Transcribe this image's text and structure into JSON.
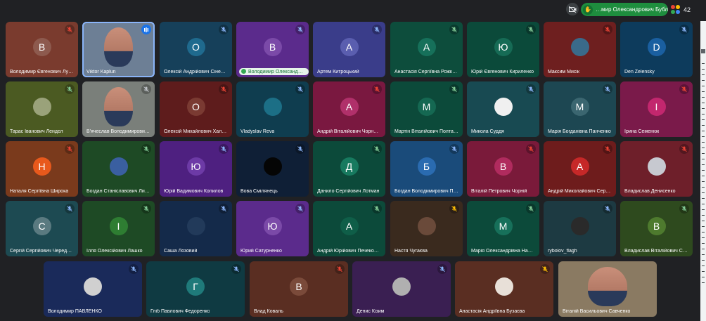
{
  "topbar": {
    "video_off_icon": "video-off-icon",
    "speaker_name": "…мир Олександрович Бубліченко",
    "people_count": "42"
  },
  "colors": {
    "mic_muted": "#ea4335",
    "mic_active": "#8ab4f8",
    "speaker_green": "#1e8e3e"
  },
  "tiles": [
    {
      "name": "Володимир Євгенович Лукін",
      "initial": "В",
      "bg": "#7a3b2e",
      "avbg": "#8d5a4e",
      "mic": "muted"
    },
    {
      "name": "Viktor Kaplun",
      "initial": "",
      "bg": "#6d7f95",
      "video": true,
      "mic": "open",
      "active": true
    },
    {
      "name": "Олексій Андрійович Сінел…",
      "initial": "О",
      "bg": "#16405a",
      "avbg": "#1f6a8e",
      "mic": "muted-blue"
    },
    {
      "name": "Володимир Олександр…",
      "initial": "В",
      "bg": "#5b2b8c",
      "avbg": "#7b4aa8",
      "mic": "muted-blue",
      "pill": true
    },
    {
      "name": "Артем Китроцький",
      "initial": "А",
      "bg": "#3a3d8a",
      "avbg": "#5a5eaf",
      "mic": "muted-blue"
    },
    {
      "name": "Анастасія Сергіївна Рожко…",
      "initial": "А",
      "bg": "#0d4d3c",
      "avbg": "#16705a",
      "mic": "muted-green"
    },
    {
      "name": "Юрій Євгенович Кириленко",
      "initial": "Ю",
      "bg": "#0b4a3a",
      "avbg": "#166b55",
      "mic": "muted-green"
    },
    {
      "name": "Максим Мисік",
      "initial": "",
      "bg": "#6e1f1f",
      "avbg": "#3a6a8a",
      "photo": true,
      "mic": "muted"
    },
    {
      "name": "Den Zelensky",
      "initial": "D",
      "bg": "#0d3b5c",
      "avbg": "#1a5fa0",
      "mic": "muted-blue"
    },
    {
      "name": "Тарас Іванович Лендєл",
      "initial": "",
      "bg": "#4b5a22",
      "avbg": "#9aa27a",
      "photo": true,
      "mic": "muted-green"
    },
    {
      "name": "В'ячеслав Володимирович …",
      "initial": "",
      "bg": "#7a7f7a",
      "video": true,
      "mic": "muted-gray"
    },
    {
      "name": "Олексій Михайлович Хала…",
      "initial": "О",
      "bg": "#5e1c1c",
      "avbg": "#7a3a32",
      "mic": "muted"
    },
    {
      "name": "Vladyslav Reva",
      "initial": "",
      "bg": "#0f3d4f",
      "avbg": "#1c6f86",
      "photo": true,
      "mic": "muted-blue"
    },
    {
      "name": "Андрій Віталійович Чорно…",
      "initial": "А",
      "bg": "#7a1840",
      "avbg": "#b0306a",
      "mic": "muted"
    },
    {
      "name": "Мартін Віталійович Полтава",
      "initial": "М",
      "bg": "#0c4a3a",
      "avbg": "#156852",
      "mic": "muted-green"
    },
    {
      "name": "Микола Суддя",
      "initial": "",
      "bg": "#184a52",
      "avbg": "#f0f0f0",
      "photo": true,
      "mic": "muted-blue"
    },
    {
      "name": "Марія Богданівна Панченко",
      "initial": "М",
      "bg": "#1d4752",
      "avbg": "#3b6670",
      "mic": "muted-blue"
    },
    {
      "name": "Ірина Семенюк",
      "initial": "І",
      "bg": "#7a1a4a",
      "avbg": "#c2276e",
      "mic": "muted"
    },
    {
      "name": "Наталя Сергіївна Широка",
      "initial": "Н",
      "bg": "#7a3a1c",
      "avbg": "#e8591c",
      "mic": "muted"
    },
    {
      "name": "Богдан Станіславович Лис…",
      "initial": "",
      "bg": "#1e4a25",
      "avbg": "#3a5fa0",
      "photo": true,
      "mic": "muted-green"
    },
    {
      "name": "Юрій Вадимович Копилов",
      "initial": "Ю",
      "bg": "#4e2080",
      "avbg": "#6d3aa6",
      "mic": "muted-blue"
    },
    {
      "name": "Вова Смілянець",
      "initial": "",
      "bg": "#0f1f36",
      "avbg": "#050505",
      "photo": true,
      "mic": "muted-blue"
    },
    {
      "name": "Данило Сергійович Лотман",
      "initial": "Д",
      "bg": "#0c4a3a",
      "avbg": "#177a5f",
      "mic": "muted-green"
    },
    {
      "name": "Богдан Володимирович Пр…",
      "initial": "Б",
      "bg": "#1a4b7a",
      "avbg": "#2a6bb0",
      "mic": "muted-blue"
    },
    {
      "name": "Віталій Петрович Чорній",
      "initial": "В",
      "bg": "#7a1a3a",
      "avbg": "#b02b5e",
      "mic": "muted"
    },
    {
      "name": "Андрій Миколайович Серд…",
      "initial": "А",
      "bg": "#6e1c1c",
      "avbg": "#c62828",
      "mic": "muted"
    },
    {
      "name": "Владислав Денисенко",
      "initial": "",
      "bg": "#6e1f2a",
      "avbg": "#c7c9d0",
      "photo": true,
      "mic": "muted"
    },
    {
      "name": "Сергій Сергійович Чередн…",
      "initial": "С",
      "bg": "#1d4a52",
      "avbg": "#5a7a80",
      "mic": "muted-blue"
    },
    {
      "name": "Ілля Олексійович Лашко",
      "initial": "І",
      "bg": "#1e4a25",
      "avbg": "#2e7d32",
      "mic": "muted-green"
    },
    {
      "name": "Саша Лозовий",
      "initial": "",
      "bg": "#142a4a",
      "avbg": "#223a5a",
      "photo": true,
      "mic": "muted-blue"
    },
    {
      "name": "Юрий Сатурненко",
      "initial": "Ю",
      "bg": "#5b2b8c",
      "avbg": "#7b4aa8",
      "mic": "muted-blue"
    },
    {
      "name": "Андрій Юрійович Печекон…",
      "initial": "А",
      "bg": "#0c4a3a",
      "avbg": "#0f5e48",
      "mic": "muted-green"
    },
    {
      "name": "Настя Чугаєва",
      "initial": "",
      "bg": "#3a2a1e",
      "avbg": "#6a4a3a",
      "photo": true,
      "mic": "muted-orange"
    },
    {
      "name": "Марія Олександрівна Наст…",
      "initial": "М",
      "bg": "#0c4a3a",
      "avbg": "#17705a",
      "mic": "muted-green"
    },
    {
      "name": "rybolov_flagh",
      "initial": "",
      "bg": "#1d3a42",
      "avbg": "#2a2a2a",
      "photo": true,
      "mic": "muted-blue"
    },
    {
      "name": "Владислав Віталійович Си…",
      "initial": "В",
      "bg": "#2e4a1e",
      "avbg": "#4e7a2e",
      "mic": "muted-green"
    },
    {
      "name": "Володимир ПАВЛЕНКО",
      "initial": "",
      "bg": "#1a2a5a",
      "avbg": "#d0d0d0",
      "photo": true,
      "mic": "muted-blue"
    },
    {
      "name": "Гліб Павлович Федоренко",
      "initial": "Г",
      "bg": "#0f3a42",
      "avbg": "#1f7a7a",
      "mic": "muted-blue"
    },
    {
      "name": "Влад Коваль",
      "initial": "В",
      "bg": "#5a2e22",
      "avbg": "#7a4a3a",
      "mic": "muted"
    },
    {
      "name": "Денис Кізим",
      "initial": "",
      "bg": "#3a1f52",
      "avbg": "#b0b0b0",
      "photo": true,
      "mic": "muted-blue"
    },
    {
      "name": "Анастасія Андріївна Бузаєва",
      "initial": "",
      "bg": "#5a2e22",
      "avbg": "#e8e0d8",
      "photo": true,
      "mic": "muted-orange"
    },
    {
      "name": "Віталій Васильович Савченко",
      "initial": "",
      "bg": "#8a7a62",
      "video": true,
      "mic": "none"
    }
  ]
}
